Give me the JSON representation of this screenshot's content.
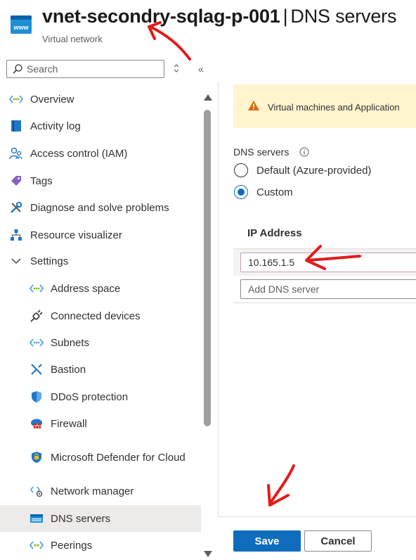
{
  "header": {
    "resource_name": "vnet-secondry-sqlag-p-001",
    "separator": "|",
    "page_name": "DNS servers",
    "resource_type": "Virtual network",
    "logo_text": "www"
  },
  "search": {
    "placeholder": "Search",
    "value": ""
  },
  "sidebar": {
    "items": [
      {
        "label": "Overview",
        "icon": "vnet-icon"
      },
      {
        "label": "Activity log",
        "icon": "activity-log-icon"
      },
      {
        "label": "Access control (IAM)",
        "icon": "iam-icon"
      },
      {
        "label": "Tags",
        "icon": "tag-icon"
      },
      {
        "label": "Diagnose and solve problems",
        "icon": "diagnose-icon"
      },
      {
        "label": "Resource visualizer",
        "icon": "visualizer-icon"
      },
      {
        "label": "Settings",
        "icon": "chevron-down-icon"
      },
      {
        "label": "Address space",
        "icon": "vnet-icon"
      },
      {
        "label": "Connected devices",
        "icon": "plug-icon"
      },
      {
        "label": "Subnets",
        "icon": "vnet-icon"
      },
      {
        "label": "Bastion",
        "icon": "bastion-icon"
      },
      {
        "label": "DDoS protection",
        "icon": "shield-icon"
      },
      {
        "label": "Firewall",
        "icon": "firewall-icon"
      },
      {
        "label": "Microsoft Defender for Cloud",
        "icon": "defender-icon"
      },
      {
        "label": "Network manager",
        "icon": "network-manager-icon"
      },
      {
        "label": "DNS servers",
        "icon": "dns-icon",
        "active": true
      },
      {
        "label": "Peerings",
        "icon": "peerings-icon"
      }
    ]
  },
  "main": {
    "warning_text": "Virtual machines and Application",
    "dns_servers_label": "DNS servers",
    "options": [
      {
        "label": "Default (Azure-provided)",
        "selected": false
      },
      {
        "label": "Custom",
        "selected": true
      }
    ],
    "ip_column_header": "IP Address",
    "ip_entries": [
      "10.165.1.5"
    ],
    "add_placeholder": "Add DNS server"
  },
  "footer": {
    "save_label": "Save",
    "cancel_label": "Cancel"
  },
  "colors": {
    "accent": "#0f6cbd",
    "warning_bg": "#fff4ce",
    "warning_icon": "#d86a0a",
    "annotation": "#e21b1b",
    "selected_row": "#edebe9"
  }
}
